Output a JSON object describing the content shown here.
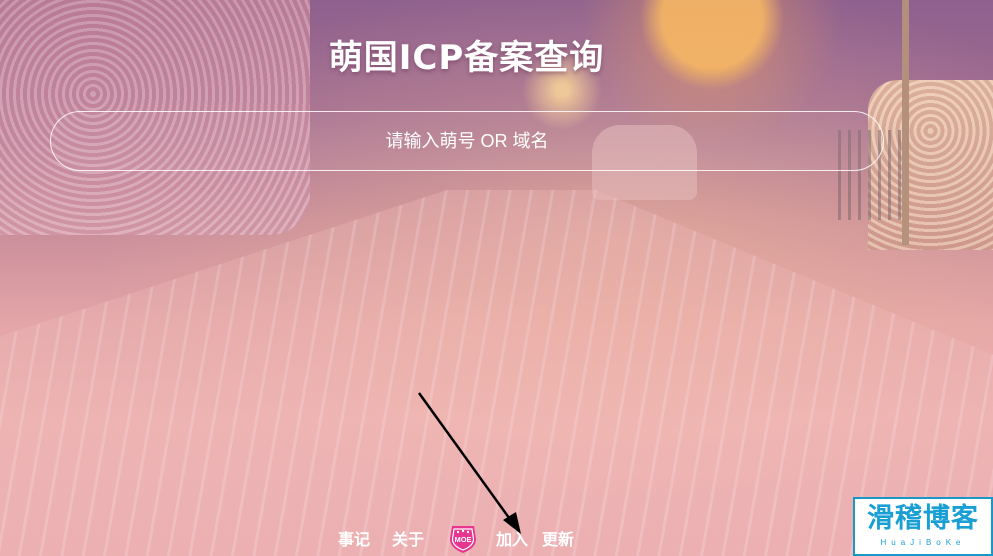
{
  "title": "萌国ICP备案查询",
  "search": {
    "placeholder": "请输入萌号 OR 域名"
  },
  "footer": {
    "events_label": "事记",
    "about_label": "关于",
    "badge_text": "MOE",
    "badge_icon": "moe-shield-icon",
    "join_label": "加入",
    "update_label": "更新"
  },
  "watermark": {
    "main": "滑稽博客",
    "sub": "HuaJiBoKe"
  },
  "colors": {
    "badge": "#e6368f",
    "logo": "#1a9fd4",
    "text": "#ffffff"
  }
}
